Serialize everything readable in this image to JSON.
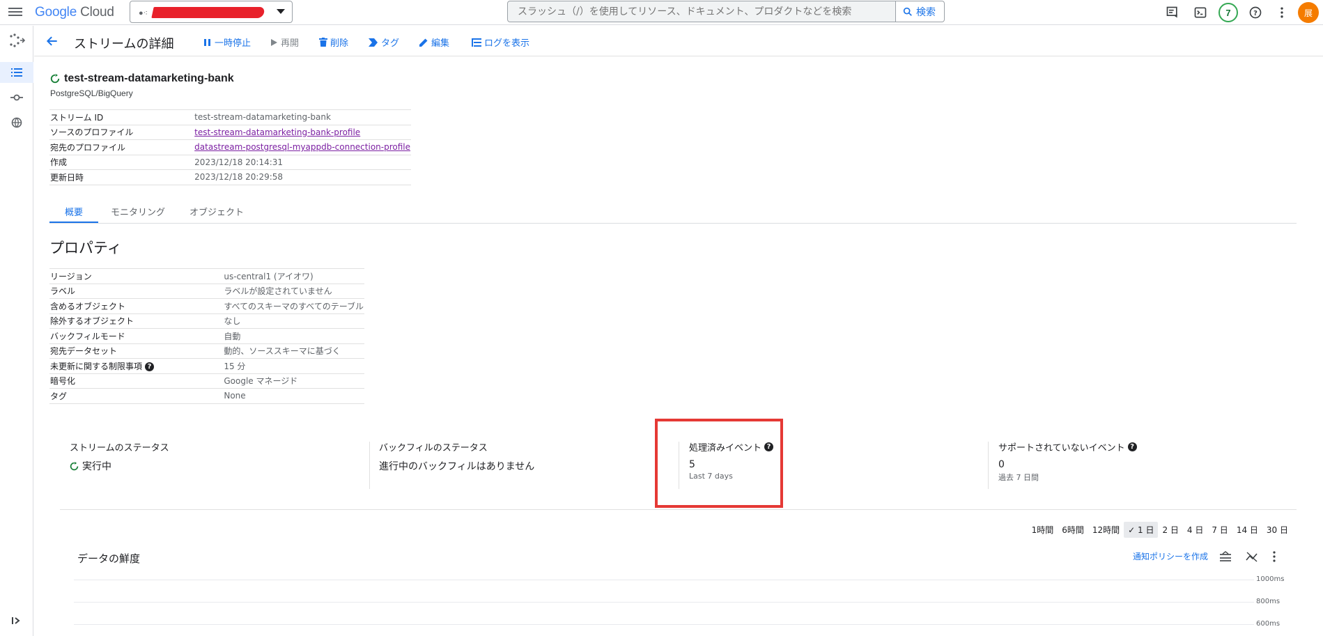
{
  "topbar": {
    "logo_google": "Google",
    "logo_cloud": "Cloud",
    "search_placeholder": "スラッシュ（/）を使用してリソース、ドキュメント、プロダクトなどを検索",
    "search_button": "検索",
    "notification_count": "7",
    "avatar_initial": "展"
  },
  "actionbar": {
    "title": "ストリームの詳細",
    "actions": [
      {
        "label": "一時停止",
        "icon": "pause-icon",
        "enabled": true
      },
      {
        "label": "再開",
        "icon": "play-icon",
        "enabled": false
      },
      {
        "label": "削除",
        "icon": "trash-icon",
        "enabled": true
      },
      {
        "label": "タグ",
        "icon": "tag-icon",
        "enabled": true
      },
      {
        "label": "編集",
        "icon": "pencil-icon",
        "enabled": true
      },
      {
        "label": "ログを表示",
        "icon": "logs-icon",
        "enabled": true
      }
    ]
  },
  "stream": {
    "name": "test-stream-datamarketing-bank",
    "subtitle": "PostgreSQL/BigQuery",
    "status_color": "#188038",
    "details": [
      {
        "key": "ストリーム ID",
        "value": "test-stream-datamarketing-bank",
        "link": false
      },
      {
        "key": "ソースのプロファイル",
        "value": "test-stream-datamarketing-bank-profile",
        "link": true
      },
      {
        "key": "宛先のプロファイル",
        "value": "datastream-postgresql-myappdb-connection-profile",
        "link": true
      },
      {
        "key": "作成",
        "value": "2023/12/18 20:14:31",
        "link": false
      },
      {
        "key": "更新日時",
        "value": "2023/12/18 20:29:58",
        "link": false
      }
    ]
  },
  "tabs": [
    {
      "label": "概要",
      "active": true
    },
    {
      "label": "モニタリング",
      "active": false
    },
    {
      "label": "オブジェクト",
      "active": false
    }
  ],
  "properties": {
    "title": "プロパティ",
    "rows": [
      {
        "key": "リージョン",
        "value": "us-central1 (アイオワ)"
      },
      {
        "key": "ラベル",
        "value": "ラベルが設定されていません"
      },
      {
        "key": "含めるオブジェクト",
        "value": "すべてのスキーマのすべてのテーブル"
      },
      {
        "key": "除外するオブジェクト",
        "value": "なし"
      },
      {
        "key": "バックフィルモード",
        "value": "自動"
      },
      {
        "key": "宛先データセット",
        "value": "動的、ソーススキーマに基づく"
      },
      {
        "key": "未更新に関する制限事項",
        "value": "15 分",
        "help": true
      },
      {
        "key": "暗号化",
        "value": "Google マネージド"
      },
      {
        "key": "タグ",
        "value": "None"
      }
    ]
  },
  "status_cards": [
    {
      "label": "ストリームのステータス",
      "value": "実行中",
      "sub": "",
      "help": false,
      "status_icon": true
    },
    {
      "label": "バックフィルのステータス",
      "value": "進行中のバックフィルはありません",
      "sub": "",
      "help": false,
      "status_icon": false
    },
    {
      "label": "処理済みイベント",
      "value": "5",
      "sub": "Last 7 days",
      "help": true,
      "status_icon": false
    },
    {
      "label": "サポートされていないイベント",
      "value": "0",
      "sub": "過去 7 日間",
      "help": true,
      "status_icon": false
    }
  ],
  "time_ranges": [
    {
      "label": "1時間",
      "selected": false
    },
    {
      "label": "6時間",
      "selected": false
    },
    {
      "label": "12時間",
      "selected": false
    },
    {
      "label": "1 日",
      "selected": true
    },
    {
      "label": "2 日",
      "selected": false
    },
    {
      "label": "4 日",
      "selected": false
    },
    {
      "label": "7 日",
      "selected": false
    },
    {
      "label": "14 日",
      "selected": false
    },
    {
      "label": "30 日",
      "selected": false
    }
  ],
  "freshness_chart": {
    "title": "データの鮮度",
    "create_alert": "通知ポリシーを作成",
    "y_ticks": [
      "1000ms",
      "800ms",
      "600ms"
    ]
  }
}
